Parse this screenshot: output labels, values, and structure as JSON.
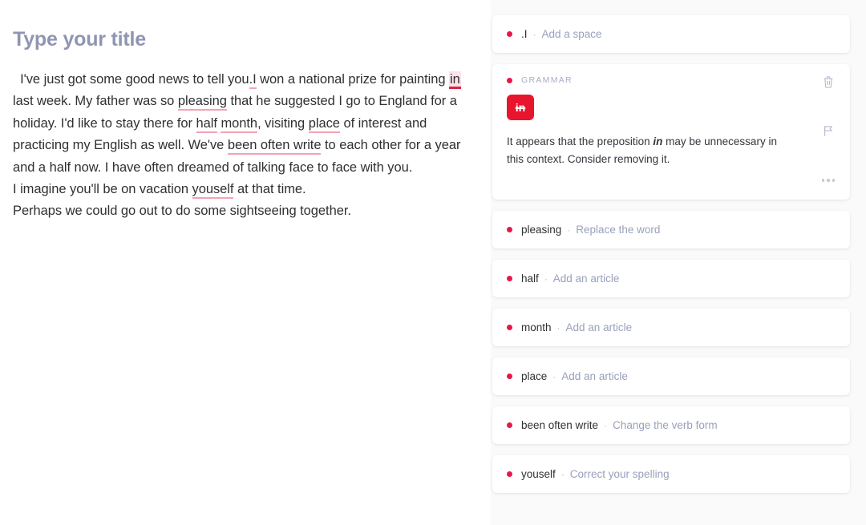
{
  "editor": {
    "title": "Type your title",
    "paragraph_segments": [
      {
        "text": "  I've just got some good news to tell you",
        "mark": "none"
      },
      {
        "text": ".I",
        "mark": "suggestion"
      },
      {
        "text": " won a national prize for painting ",
        "mark": "none"
      },
      {
        "text": "in",
        "mark": "active"
      },
      {
        "text": " last week. My father was so ",
        "mark": "none"
      },
      {
        "text": "pleasing",
        "mark": "suggestion"
      },
      {
        "text": " that he suggested I go to England for a holiday. I'd like to stay there for ",
        "mark": "none"
      },
      {
        "text": "half",
        "mark": "suggestion"
      },
      {
        "text": " ",
        "mark": "none"
      },
      {
        "text": "month",
        "mark": "suggestion"
      },
      {
        "text": ", visiting ",
        "mark": "none"
      },
      {
        "text": "place",
        "mark": "suggestion"
      },
      {
        "text": " of interest and practicing my English as well. We've ",
        "mark": "none"
      },
      {
        "text": "been often write",
        "mark": "suggestion"
      },
      {
        "text": " to each other for a year and a half now. I have often dreamed of talking face to face with you.\nI imagine you'll be on vacation ",
        "mark": "none"
      },
      {
        "text": "youself",
        "mark": "suggestion"
      },
      {
        "text": " at that time.\nPerhaps we could go out to do some sightseeing together.",
        "mark": "none"
      }
    ]
  },
  "sidebar": {
    "cards": [
      {
        "state": "collapsed",
        "word": ".I",
        "separator": "·",
        "action": "Add a space"
      },
      {
        "state": "expanded",
        "category": "GRAMMAR",
        "chip": "in",
        "explanation_before": "It appears that the preposition ",
        "explanation_emphasis": "in",
        "explanation_after": " may be unnecessary in this context. Consider removing it.",
        "actions": {
          "delete": "trash-icon",
          "flag": "flag-icon",
          "more": "more-options-icon"
        }
      },
      {
        "state": "collapsed",
        "word": "pleasing",
        "separator": "·",
        "action": "Replace the word"
      },
      {
        "state": "collapsed",
        "word": "half",
        "separator": "·",
        "action": "Add an article"
      },
      {
        "state": "collapsed",
        "word": "month",
        "separator": "·",
        "action": "Add an article"
      },
      {
        "state": "collapsed",
        "word": "place",
        "separator": "·",
        "action": "Add an article"
      },
      {
        "state": "collapsed",
        "word": "been often write",
        "separator": "·",
        "action": "Change the verb form"
      },
      {
        "state": "collapsed",
        "word": "youself",
        "separator": "·",
        "action": "Correct your spelling"
      }
    ]
  },
  "colors": {
    "accent_red": "#e8174a",
    "chip_red": "#e8152f",
    "title_blue_gray": "#8f95b2",
    "action_text": "#9aa0bb",
    "underline_pink": "#f2a3b4",
    "underline_active": "#d6243f",
    "highlight_active": "#fde2e8",
    "page_background": "#fafafb",
    "card_background": "#ffffff"
  }
}
